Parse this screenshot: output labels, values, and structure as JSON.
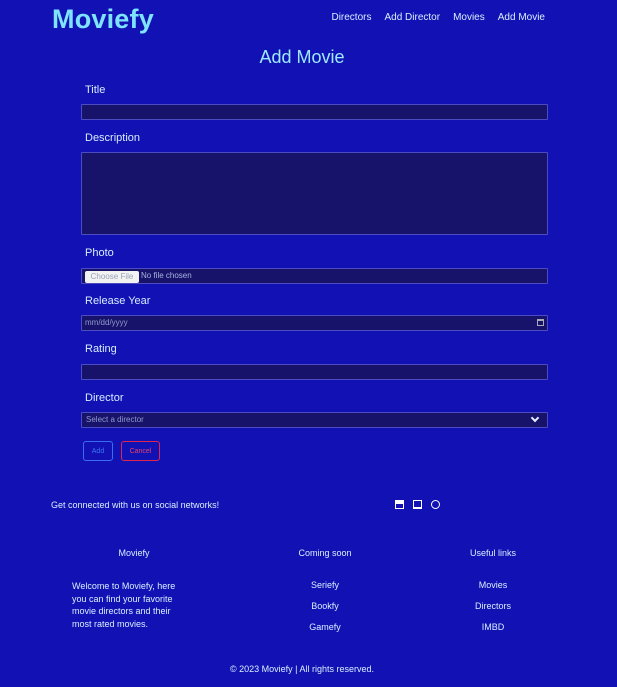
{
  "brand": "Moviefy",
  "nav": [
    "Directors",
    "Add Director",
    "Movies",
    "Add Movie"
  ],
  "page_title": "Add Movie",
  "form": {
    "title_label": "Title",
    "description_label": "Description",
    "photo_label": "Photo",
    "photo_button": "Choose File",
    "photo_status": "No file chosen",
    "release_label": "Release Year",
    "release_placeholder": "mm/dd/yyyy",
    "rating_label": "Rating",
    "director_label": "Director",
    "director_selected": "Select a director",
    "add_label": "Add",
    "cancel_label": "Cancel"
  },
  "footer": {
    "social_text": "Get connected with us on social networks!",
    "social_icons": [
      "card-icon",
      "monitor-icon",
      "github-icon"
    ],
    "col1_title": "Moviefy",
    "col1_text": "Welcome to Moviefy, here you can find your favorite movie directors and their most rated movies.",
    "col2_title": "Coming soon",
    "col2_links": [
      "Seriefy",
      "Bookfy",
      "Gamefy"
    ],
    "col3_title": "Useful links",
    "col3_links": [
      "Movies",
      "Directors",
      "IMBD"
    ],
    "copyright": "© 2023 Moviefy | All rights reserved."
  },
  "colors": {
    "background": "#1212b4",
    "logo": "#7ee3ff",
    "field": "#18136a",
    "add_button": "#3b6df0",
    "cancel_button": "#e0264f"
  }
}
